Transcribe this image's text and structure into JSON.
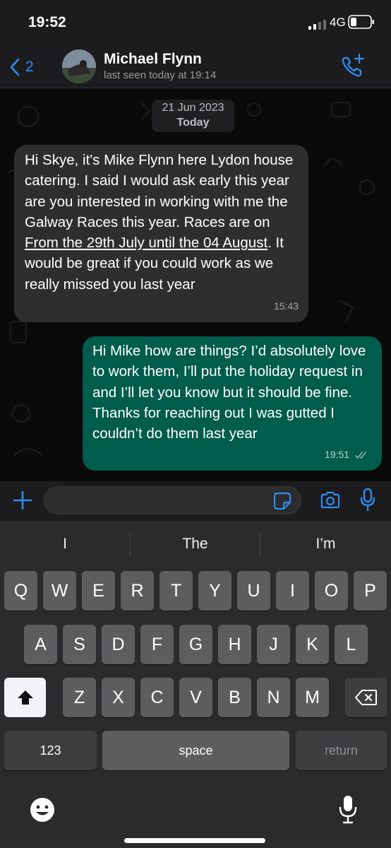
{
  "status": {
    "time": "19:52",
    "network": "4G"
  },
  "header": {
    "back_count": "2",
    "contact_name": "Michael Flynn",
    "contact_status": "last seen today at 19:14"
  },
  "chat": {
    "date_chip": {
      "date": "21 Jun 2023",
      "label": "Today"
    },
    "messages": [
      {
        "direction": "incoming",
        "text_before_link": "Hi Skye, it's Mike Flynn here Lydon house catering. I said I would ask early this year are you interested in working with me the Galway Races this year.  Races are on ",
        "link_text": "From the 29th July until the 04 August",
        "text_after_link": ". It would be great if you could work as we really missed you last year",
        "time": "15:43"
      },
      {
        "direction": "outgoing",
        "text": "Hi Mike how are things? I’d absolutely love to work them, I’ll put the holiday request in and I’ll let you know but it should be fine. Thanks for reaching out I was gutted I couldn’t do them last year",
        "time": "19:51",
        "status_icon": "double-check-icon"
      }
    ]
  },
  "compose": {
    "placeholder": ""
  },
  "keyboard": {
    "suggestions": [
      "I",
      "The",
      "I’m"
    ],
    "row1": [
      "Q",
      "W",
      "E",
      "R",
      "T",
      "Y",
      "U",
      "I",
      "O",
      "P"
    ],
    "row2": [
      "A",
      "S",
      "D",
      "F",
      "G",
      "H",
      "J",
      "K",
      "L"
    ],
    "row3": [
      "Z",
      "X",
      "C",
      "V",
      "B",
      "N",
      "M"
    ],
    "numbers_label": "123",
    "space_label": "space",
    "return_label": "return"
  },
  "colors": {
    "accent": "#2f8cf0",
    "incoming_bubble": "#2e2e30",
    "outgoing_bubble": "#005c4b"
  }
}
